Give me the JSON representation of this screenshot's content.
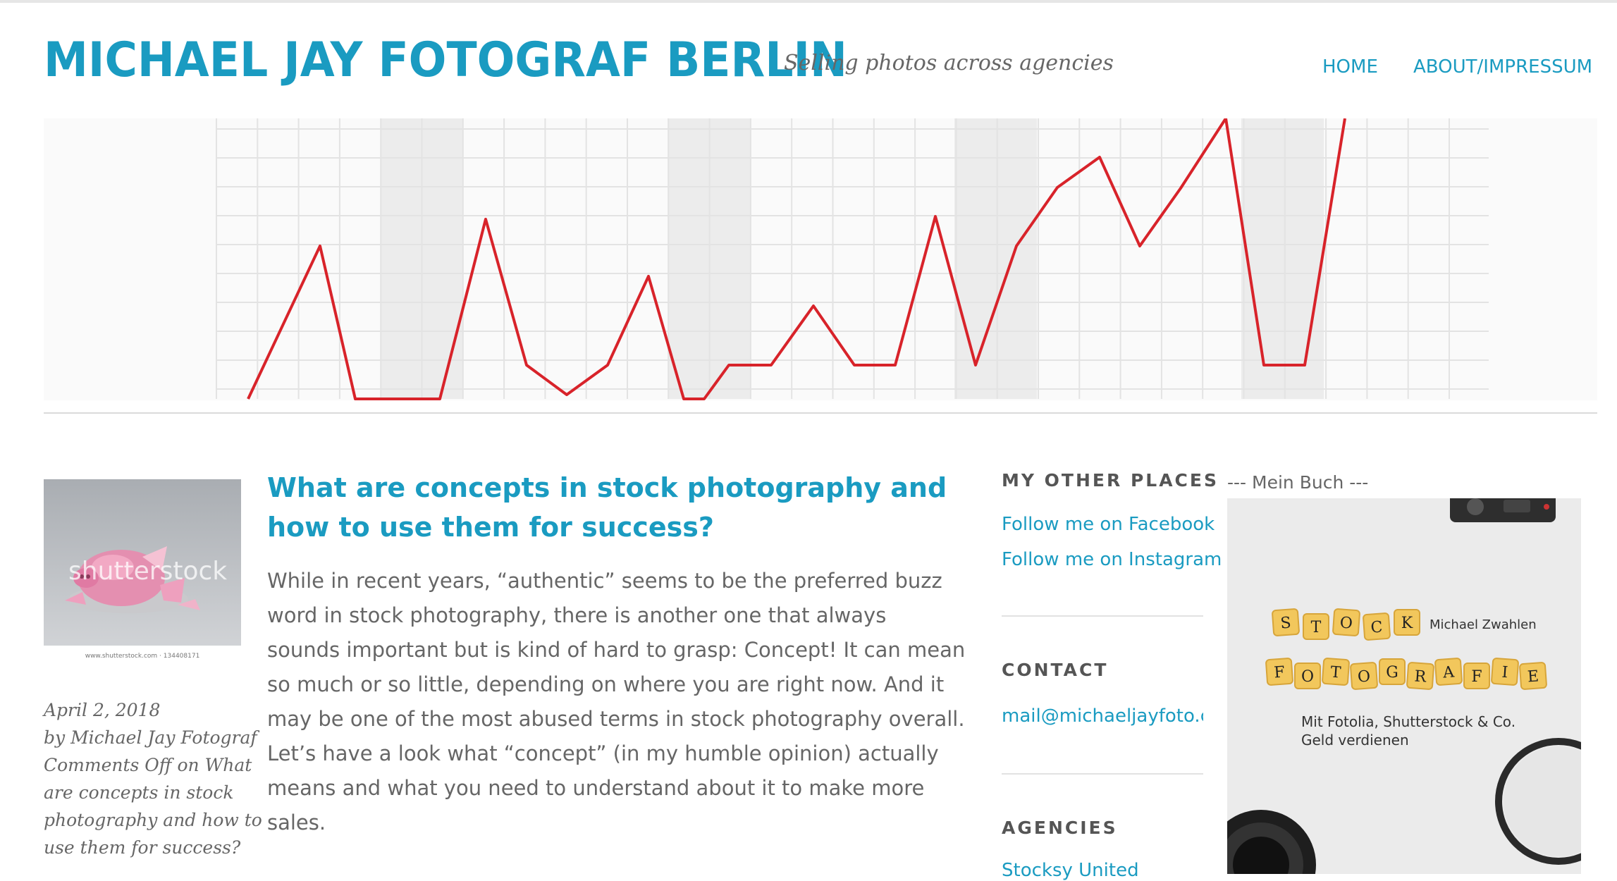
{
  "site": {
    "title": "MICHAEL JAY FOTOGRAF BERLIN",
    "tagline": "Selling photos across agencies"
  },
  "nav": [
    {
      "label": "HOME"
    },
    {
      "label": "ABOUT/IMPRESSUM"
    }
  ],
  "post": {
    "title_lines": [
      "What are concepts in stock photography and",
      "how to use them for success?"
    ],
    "excerpt_lines": [
      "While in recent years, “authentic” seems to be the preferred buzz",
      "word in stock photography, there is another one that always",
      "sounds important but is kind of hard to grasp: Concept! It can mean",
      "so much or so little, depending on where you are right now. And it",
      "may be one of the most abused terms in stock photography overall.",
      "Let’s have a look what “concept” (in my humble opinion) actually",
      "means and what you need to understand about it to make more",
      "sales."
    ],
    "meta_lines": [
      "April 2, 2018",
      "by Michael Jay Fotograf",
      "Comments Off on What",
      "are concepts in stock",
      "photography and how to",
      "use them for success?"
    ],
    "thumbnail": {
      "watermark": "shutterstock",
      "caption": "www.shutterstock.com · 134408171"
    }
  },
  "sidebar": {
    "other_places": {
      "title": "MY OTHER PLACES",
      "links": [
        "Follow me on Facebook",
        "Follow me on Instagram"
      ]
    },
    "contact": {
      "title": "CONTACT",
      "email": "mail@michaeljayfoto.com"
    },
    "agencies": {
      "title": "AGENCIES",
      "first_link": "Stocksy United"
    }
  },
  "book": {
    "label": "--- Mein Buch ---",
    "word1": "STOCK",
    "word2": "FOTOGRAFIE",
    "author": "Michael Zwahlen",
    "subtitle_lines": [
      "Mit Fotolia, Shutterstock & Co.",
      "Geld verdienen"
    ]
  },
  "colors": {
    "accent": "#1a9bc1",
    "chart_line": "#d8232a",
    "text": "#666666"
  }
}
